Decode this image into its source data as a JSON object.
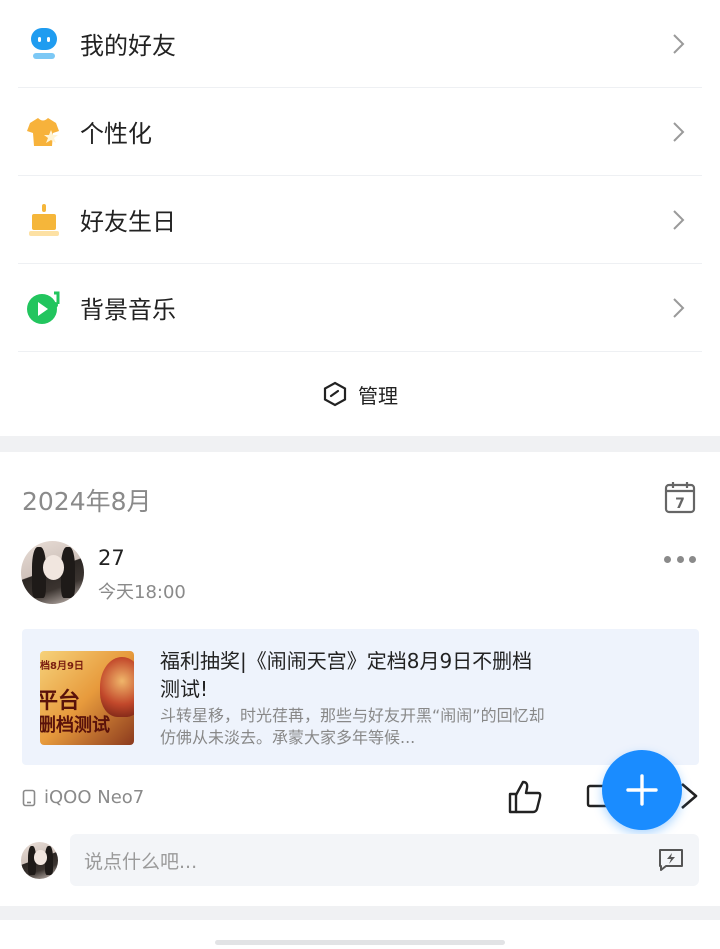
{
  "menu": {
    "items": [
      {
        "label": "我的好友",
        "icon": "robot-icon"
      },
      {
        "label": "个性化",
        "icon": "tshirt-star-icon"
      },
      {
        "label": "好友生日",
        "icon": "cake-icon"
      },
      {
        "label": "背景音乐",
        "icon": "music-disc-icon"
      }
    ],
    "manage_label": "管理"
  },
  "feed": {
    "month": "2024年8月",
    "calendar_day": "7",
    "post": {
      "username": "27",
      "time": "今天18:00",
      "card": {
        "thumb_top": "档8月9日",
        "thumb_mid": "平台",
        "thumb_bottom": "删档测试",
        "title": "福利抽奖|《闹闹天宫》定档8月9日不删档测试!",
        "desc": "斗转星移，时光荏苒，那些与好友开黑“闹闹”的回忆却仿佛从未淡去。承蒙大家多年等候..."
      },
      "device": "iQOO Neo7"
    },
    "comment_placeholder": "说点什么吧..."
  },
  "colors": {
    "accent": "#1a8cff",
    "card_bg": "#eef3fc",
    "separator": "#f0f1f3",
    "muted_text": "#8a8a8a"
  }
}
